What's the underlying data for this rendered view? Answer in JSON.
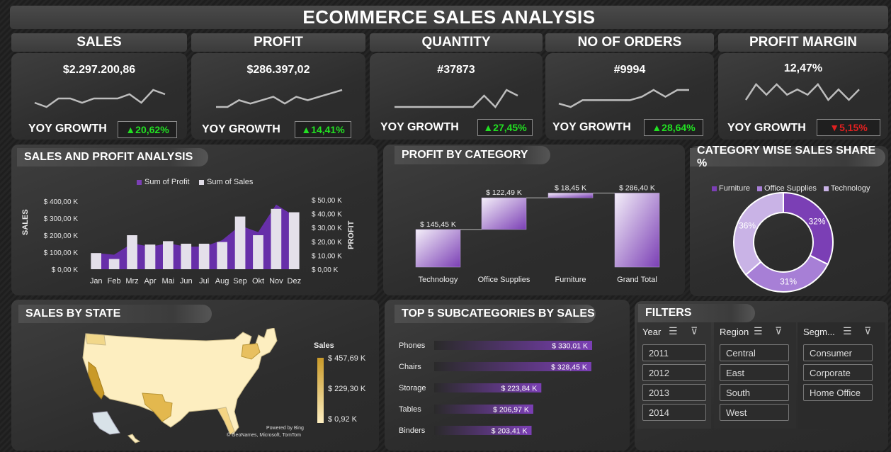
{
  "title": "ECOMMERCE SALES ANALYSIS",
  "kpis": [
    {
      "label": "SALES",
      "value": "$2.297.200,86",
      "yoy_label": "YOY GROWTH",
      "yoy": "▲20,62%",
      "trend": "up",
      "spark": [
        4,
        3,
        5,
        5,
        4,
        5,
        5,
        5,
        6,
        4,
        7,
        6
      ]
    },
    {
      "label": "PROFIT",
      "value": "$286.397,02",
      "yoy_label": "YOY GROWTH",
      "yoy": "▲14,41%",
      "trend": "up",
      "spark": [
        3,
        3,
        5,
        4,
        5,
        6,
        4,
        6,
        5,
        6,
        7,
        8
      ]
    },
    {
      "label": "QUANTITY",
      "value": "#37873",
      "yoy_label": "YOY GROWTH",
      "yoy": "▲27,45%",
      "trend": "up",
      "spark": [
        3,
        3,
        3,
        3,
        3,
        3,
        3,
        3,
        5,
        3,
        6,
        5
      ]
    },
    {
      "label": "NO OF ORDERS",
      "value": "#9994",
      "yoy_label": "YOY GROWTH",
      "yoy": "▲28,64%",
      "trend": "up",
      "spark": [
        3,
        2,
        4,
        4,
        4,
        4,
        4,
        5,
        7,
        5,
        7,
        7
      ]
    },
    {
      "label": "PROFIT MARGIN",
      "value": "12,47%",
      "yoy_label": "YOY GROWTH",
      "yoy": "▼5,15%",
      "trend": "down",
      "spark": [
        5,
        8,
        6,
        8,
        6,
        7,
        6,
        8,
        5,
        7,
        5,
        7
      ]
    }
  ],
  "sales_profit": {
    "title": "SALES AND PROFIT ANALYSIS",
    "legend_profit": "Sum of Profit",
    "legend_sales": "Sum of Sales",
    "ylabel_left": "SALES",
    "ylabel_right": "PROFIT",
    "left_ticks": [
      "$ 400,00 K",
      "$ 300,00 K",
      "$ 200,00 K",
      "$ 100,00 K",
      "$ 0,00 K"
    ],
    "right_ticks": [
      "$ 50,00 K",
      "$ 40,00 K",
      "$ 30,00 K",
      "$ 20,00 K",
      "$ 10,00 K",
      "$ 0,00 K"
    ]
  },
  "profit_category": {
    "title": "PROFIT BY CATEGORY"
  },
  "share": {
    "title": "CATEGORY WISE SALES SHARE %"
  },
  "state": {
    "title": "SALES BY STATE",
    "legend_title": "Sales",
    "legend_max": "$ 457,69 K",
    "legend_mid": "$ 229,30 K",
    "legend_min": "$ 0,92 K",
    "powered": "Powered by Bing",
    "credit": "© GeoNames, Microsoft, TomTom"
  },
  "subcat": {
    "title": "TOP 5 SUBCATEGORIES BY SALES"
  },
  "filters": {
    "title": "FILTERS",
    "year": {
      "label": "Year",
      "items": [
        "2011",
        "2012",
        "2013",
        "2014"
      ]
    },
    "region": {
      "label": "Region",
      "items": [
        "Central",
        "East",
        "South",
        "West"
      ]
    },
    "segment": {
      "label": "Segm...",
      "items": [
        "Consumer",
        "Corporate",
        "Home Office"
      ]
    }
  },
  "chart_data": [
    {
      "type": "bar",
      "title": "SALES AND PROFIT ANALYSIS",
      "categories": [
        "Jan",
        "Feb",
        "Mrz",
        "Apr",
        "Mai",
        "Jun",
        "Jul",
        "Aug",
        "Sep",
        "Okt",
        "Nov",
        "Dez"
      ],
      "series": [
        {
          "name": "Sum of Sales",
          "axis": "left",
          "values": [
            95,
            60,
            200,
            145,
            165,
            150,
            150,
            160,
            310,
            200,
            355,
            335
          ]
        },
        {
          "name": "Sum of Profit",
          "axis": "right",
          "type": "area",
          "values": [
            10,
            9,
            16,
            14,
            16,
            14,
            14,
            18,
            27,
            23,
            40,
            33
          ]
        }
      ],
      "ylim": [
        0,
        400
      ],
      "ylim_right": [
        0,
        50
      ]
    },
    {
      "type": "bar",
      "subtype": "waterfall",
      "title": "PROFIT BY CATEGORY",
      "categories": [
        "Technology",
        "Office Supplies",
        "Furniture",
        "Grand Total"
      ],
      "values": [
        145.45,
        122.49,
        18.45,
        286.4
      ],
      "labels": [
        "$ 145,45 K",
        "$ 122,49 K",
        "$ 18,45 K",
        "$ 286,40 K"
      ]
    },
    {
      "type": "pie",
      "title": "CATEGORY WISE SALES SHARE %",
      "categories": [
        "Furniture",
        "Office Supplies",
        "Technology"
      ],
      "values": [
        32,
        31,
        36
      ],
      "labels": [
        "32%",
        "31%",
        "36%"
      ],
      "colors": [
        "#7b3fb5",
        "#a77fd6",
        "#c9b3e6"
      ]
    },
    {
      "type": "bar",
      "orientation": "horizontal",
      "title": "TOP 5 SUBCATEGORIES BY SALES",
      "categories": [
        "Phones",
        "Chairs",
        "Storage",
        "Tables",
        "Binders"
      ],
      "values": [
        330.01,
        328.45,
        223.84,
        206.97,
        203.41
      ],
      "labels": [
        "$ 330,01 K",
        "$ 328,45 K",
        "$ 223,84 K",
        "$ 206,97 K",
        "$ 203,41 K"
      ]
    }
  ],
  "colors": {
    "accent": "#7b3fb5",
    "accent_light": "#c9b3e6",
    "up": "#22e022",
    "down": "#e02020",
    "map_low": "#fdf0c4",
    "map_high": "#d4a020"
  }
}
